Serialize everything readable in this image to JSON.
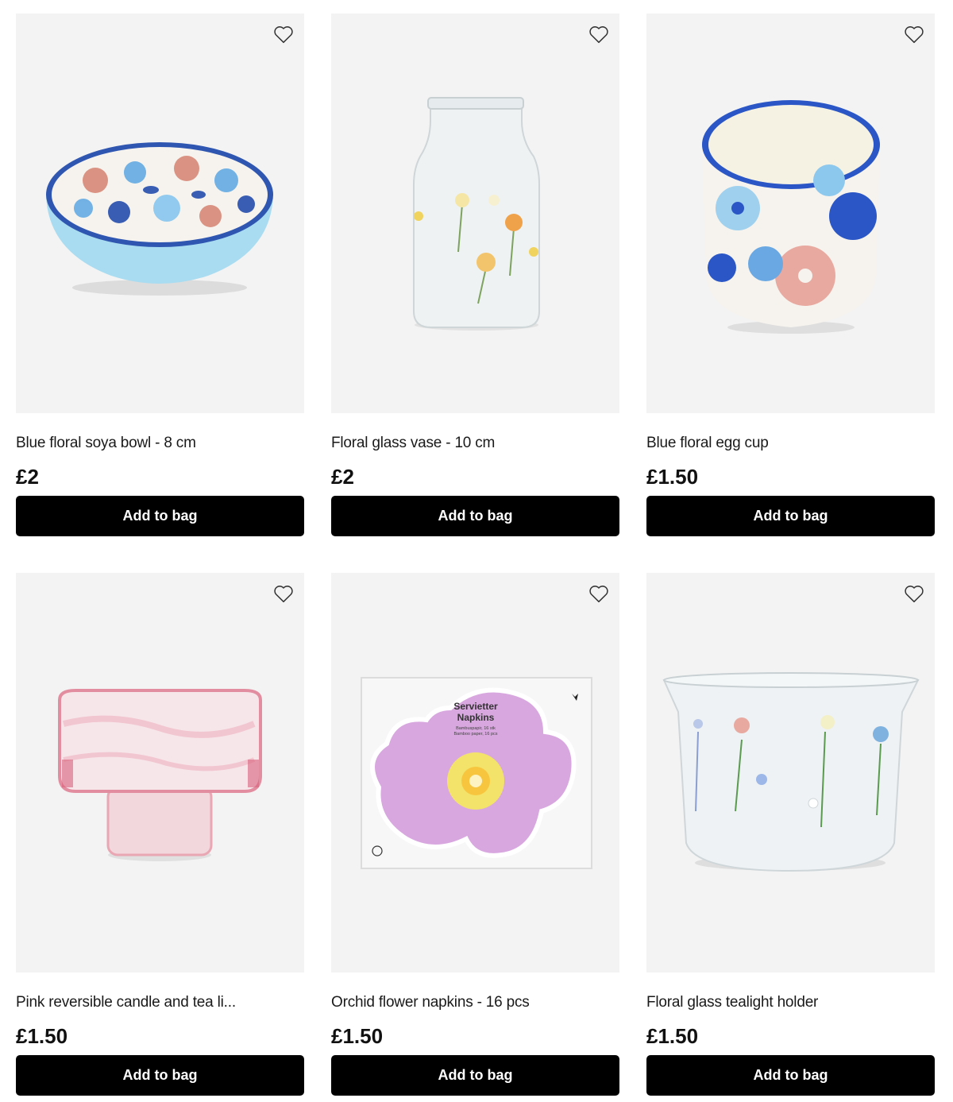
{
  "products": [
    {
      "title": "Blue floral soya bowl - 8 cm",
      "price": "£2",
      "button": "Add to bag",
      "image_icon": "floral-bowl-image"
    },
    {
      "title": "Floral glass vase - 10 cm",
      "price": "£2",
      "button": "Add to bag",
      "image_icon": "glass-vase-image"
    },
    {
      "title": "Blue floral egg cup",
      "price": "£1.50",
      "button": "Add to bag",
      "image_icon": "egg-cup-image"
    },
    {
      "title": "Pink reversible candle and tea li...",
      "price": "£1.50",
      "button": "Add to bag",
      "image_icon": "candle-holder-image"
    },
    {
      "title": "Orchid flower napkins - 16 pcs",
      "price": "£1.50",
      "button": "Add to bag",
      "image_icon": "napkins-image"
    },
    {
      "title": "Floral glass tealight holder",
      "price": "£1.50",
      "button": "Add to bag",
      "image_icon": "tealight-holder-image"
    }
  ],
  "napkin_pack": {
    "line1": "Servietter",
    "line2": "Napkins",
    "line3": "Bambuspapir, 16 stk",
    "line4": "Bamboo paper, 16 pcs"
  },
  "wishlist_icon": "heart-outline-icon",
  "colors": {
    "card_background": "#f3f3f3",
    "button_background": "#000000",
    "button_text": "#ffffff"
  }
}
